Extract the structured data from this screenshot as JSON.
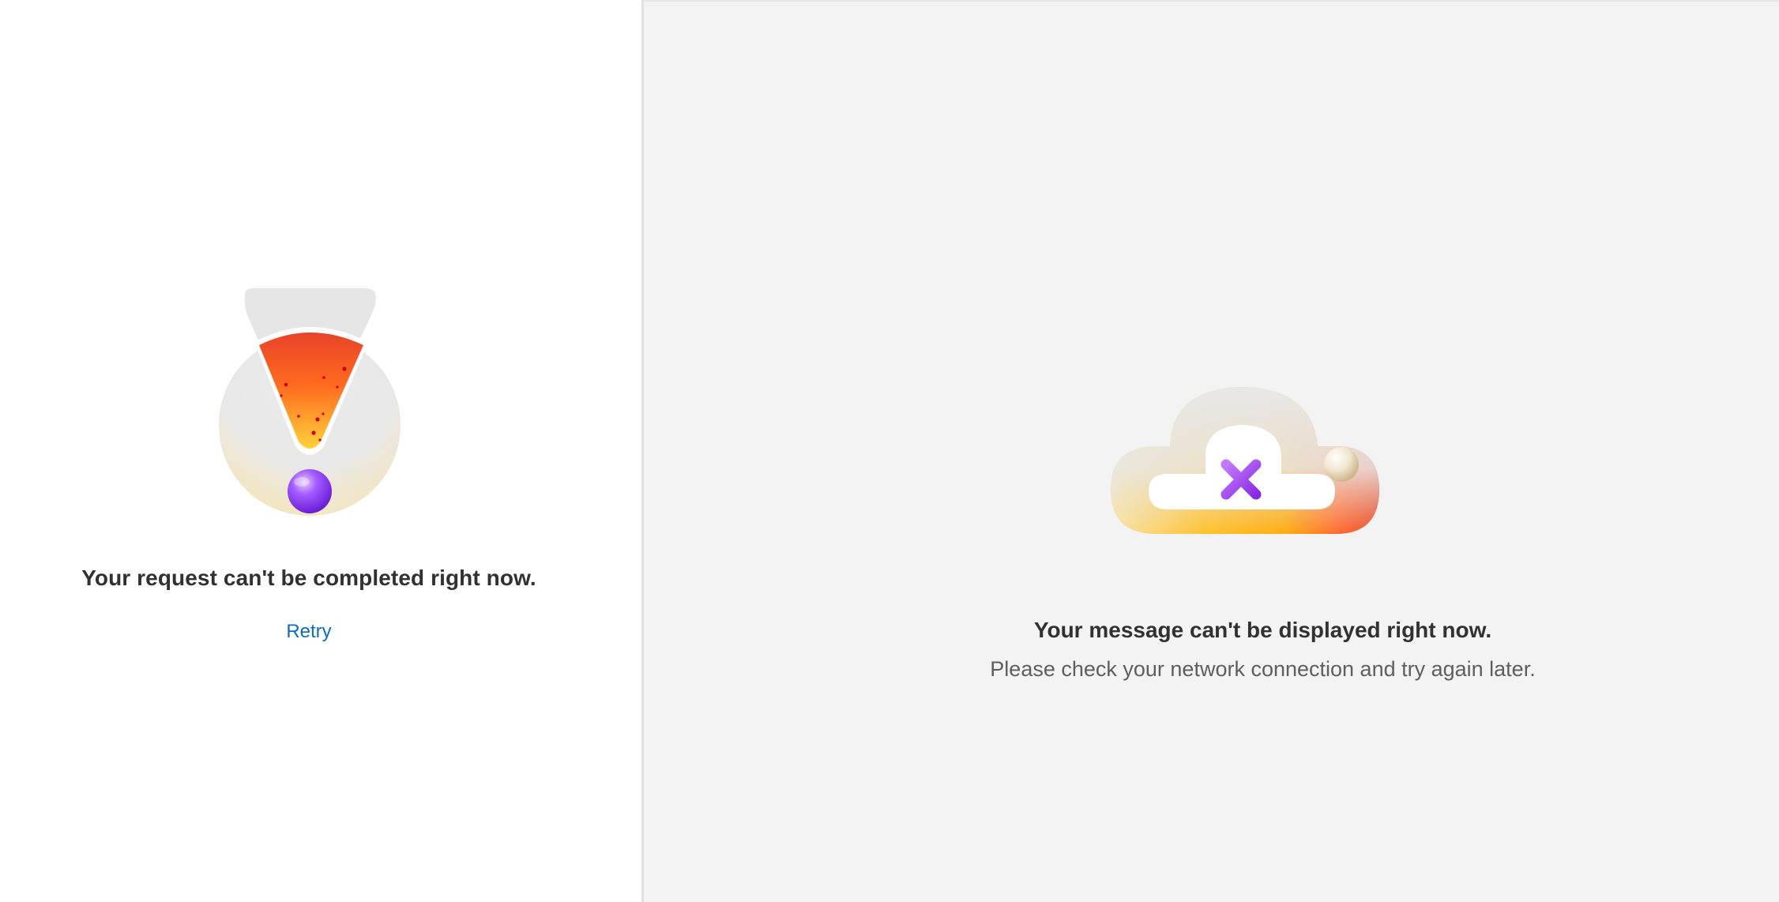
{
  "left_panel": {
    "error_title": "Your request can't be completed right now.",
    "retry_label": "Retry",
    "illustration": "exclamation-error-icon"
  },
  "right_panel": {
    "error_title": "Your message can't be displayed right now.",
    "error_detail": "Please check your network connection and try again later.",
    "illustration": "cloud-error-icon"
  },
  "colors": {
    "link": "#0f6cbd",
    "title_text": "#323130",
    "detail_text": "#605e5c",
    "pane_bg": "#f3f3f3",
    "accent_purple": "#8b3dff",
    "accent_orange": "#ff5a2b",
    "accent_yellow": "#ffb800"
  }
}
